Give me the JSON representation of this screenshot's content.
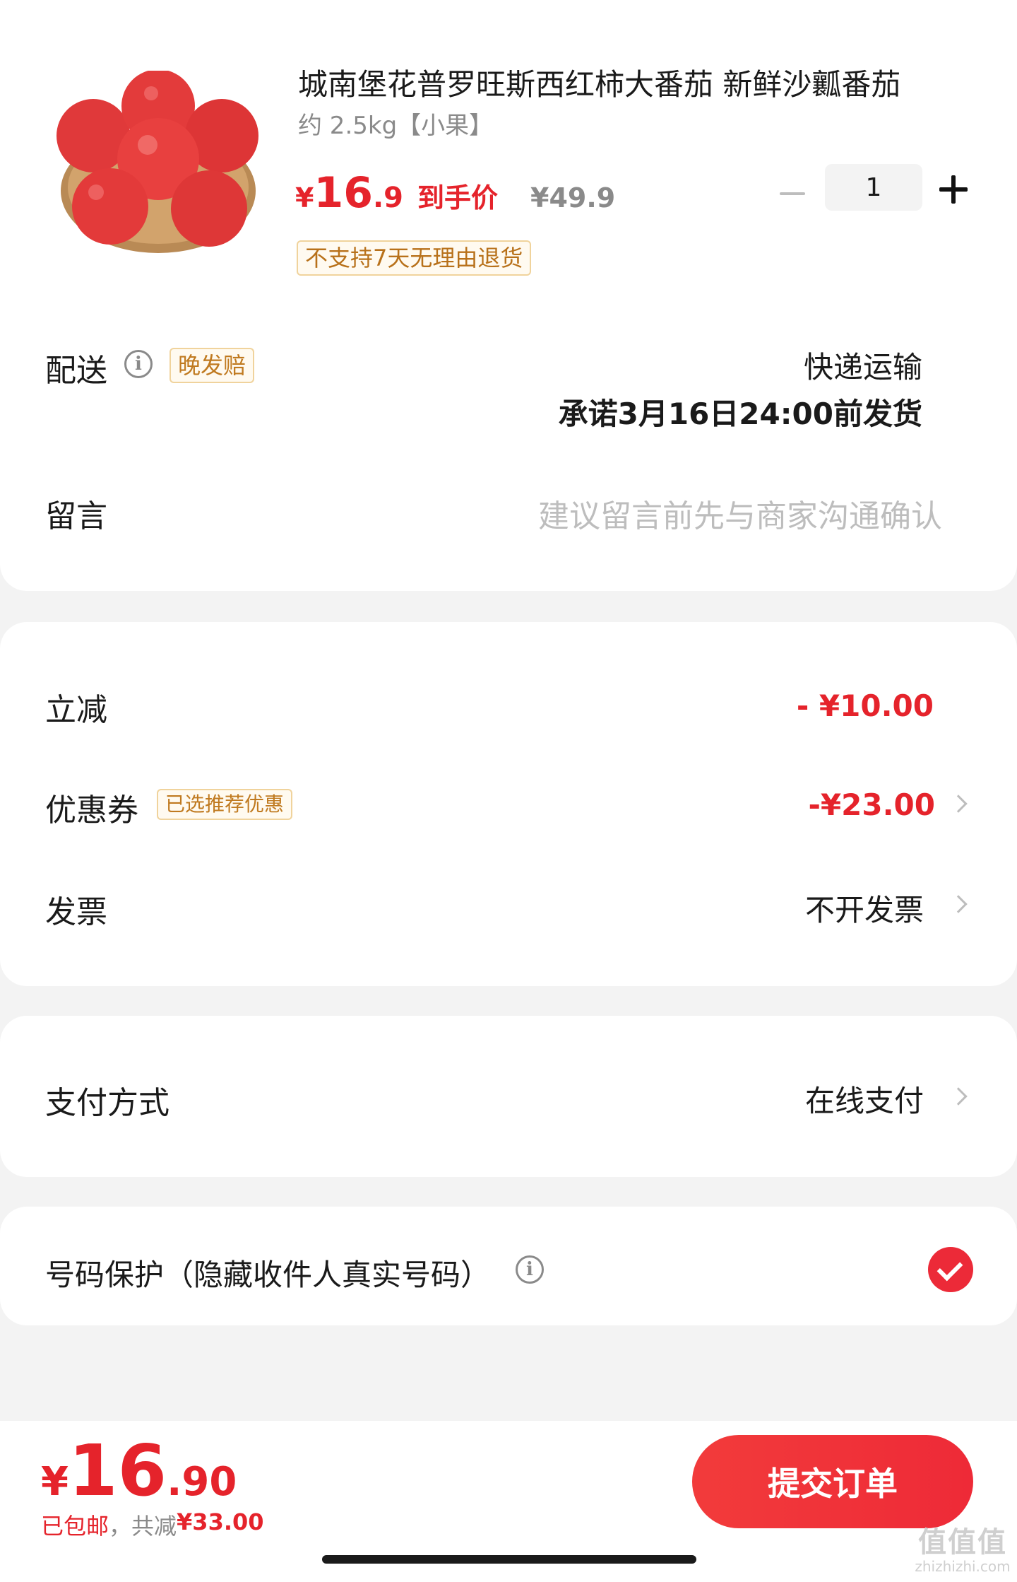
{
  "product": {
    "title": "城南堡花普罗旺斯西红柿大番茄 新鲜沙瓤番茄",
    "spec": "约 2.5kg【小果】",
    "price_symbol": "¥",
    "price_integer": "16",
    "price_decimal": ".9",
    "price_tag": "到手价",
    "original_price": "¥49.9",
    "quantity": "1",
    "return_policy": "不支持7天无理由退货",
    "image_icon": "tomato-image"
  },
  "delivery": {
    "label": "配送",
    "info_icon": "i",
    "late_badge": "晚发赔",
    "method": "快递运输",
    "promise": "承诺3月16日24:00前发货"
  },
  "message": {
    "label": "留言",
    "placeholder": "建议留言前先与商家沟通确认"
  },
  "discount": {
    "instant_label": "立减",
    "instant_value": "- ¥10.00",
    "coupon_label": "优惠券",
    "coupon_badge": "已选推荐优惠",
    "coupon_value": "-¥23.00",
    "invoice_label": "发票",
    "invoice_value": "不开发票"
  },
  "payment": {
    "label": "支付方式",
    "value": "在线支付"
  },
  "privacy": {
    "label": "号码保护（隐藏收件人真实号码）",
    "info_icon": "i",
    "checked": true
  },
  "footer": {
    "total_symbol": "¥",
    "total_integer": "16",
    "total_decimal": ".90",
    "shipping_note": "已包邮",
    "discount_prefix": "，共减",
    "discount_total": "¥33.00",
    "submit_label": "提交订单"
  },
  "watermark": {
    "logo_text": "值值值",
    "domain_text": "zhizhizhi.com"
  },
  "colors": {
    "accent_red": "#e5232b",
    "badge_border": "#f0d39c",
    "badge_text": "#c07a20",
    "muted_text": "#8a8a8a"
  }
}
